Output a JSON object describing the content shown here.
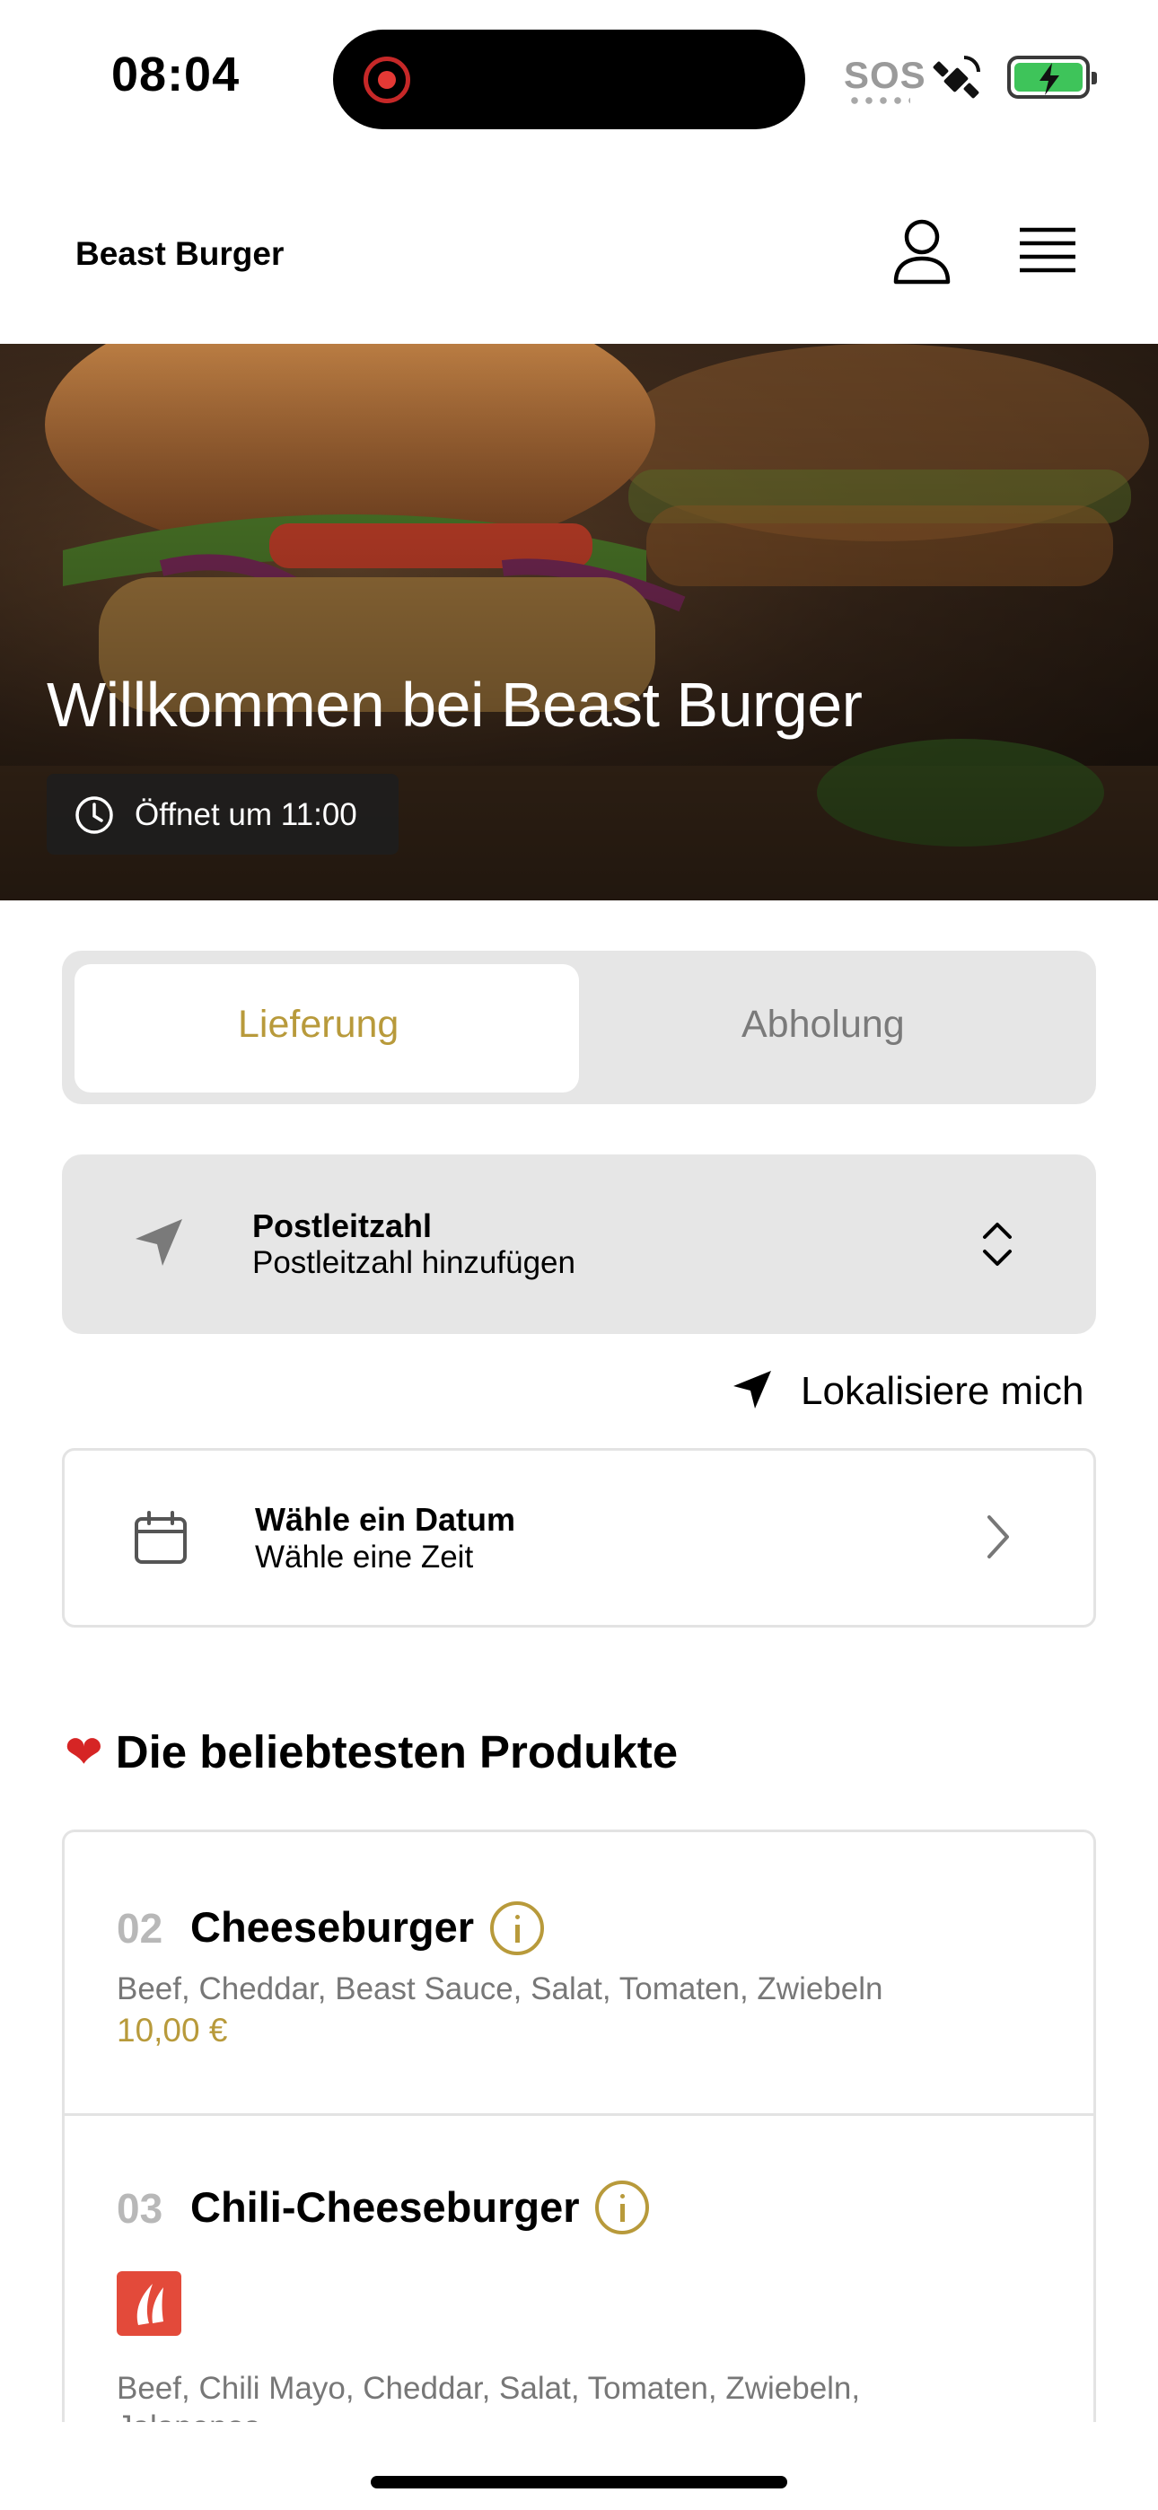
{
  "status_bar": {
    "time": "08:04",
    "sos": "SOS",
    "icons": [
      "recording-dot-icon",
      "satellite-icon",
      "battery-charging-icon"
    ],
    "battery_color": "#3ec45a"
  },
  "header": {
    "brand": "Beast Burger",
    "icons": [
      "user-icon",
      "menu-icon"
    ]
  },
  "hero": {
    "welcome": "Willkommen bei Beast Burger",
    "opening": "Öffnet um 11:00",
    "opening_icon": "clock-icon"
  },
  "order_mode": {
    "options": [
      "Lieferung",
      "Abholung"
    ],
    "selected": "Lieferung",
    "accent": "#b89a3b"
  },
  "postal_code": {
    "title": "Postleitzahl",
    "placeholder": "Postleitzahl hinzufügen",
    "icon": "location-arrow-icon"
  },
  "locate": {
    "label": "Lokalisiere mich",
    "icon": "location-arrow-icon"
  },
  "schedule": {
    "title": "Wähle ein Datum",
    "subtitle": "Wähle eine Zeit",
    "icon": "calendar-icon"
  },
  "popular": {
    "heading_icon": "heart-icon",
    "heading": "Die beliebtesten Produkte",
    "products": [
      {
        "number": "02",
        "name": "Cheeseburger",
        "description": "Beef, Cheddar, Beast Sauce, Salat, Tomaten, Zwiebeln",
        "price": "10,00 €"
      },
      {
        "number": "03",
        "name": "Chili-Cheeseburger",
        "description": "Beef, Chili Mayo, Cheddar, Salat, Tomaten, Zwiebeln,",
        "description_cont": "Jalapenos",
        "badge_icon": "chili-icon"
      }
    ]
  }
}
